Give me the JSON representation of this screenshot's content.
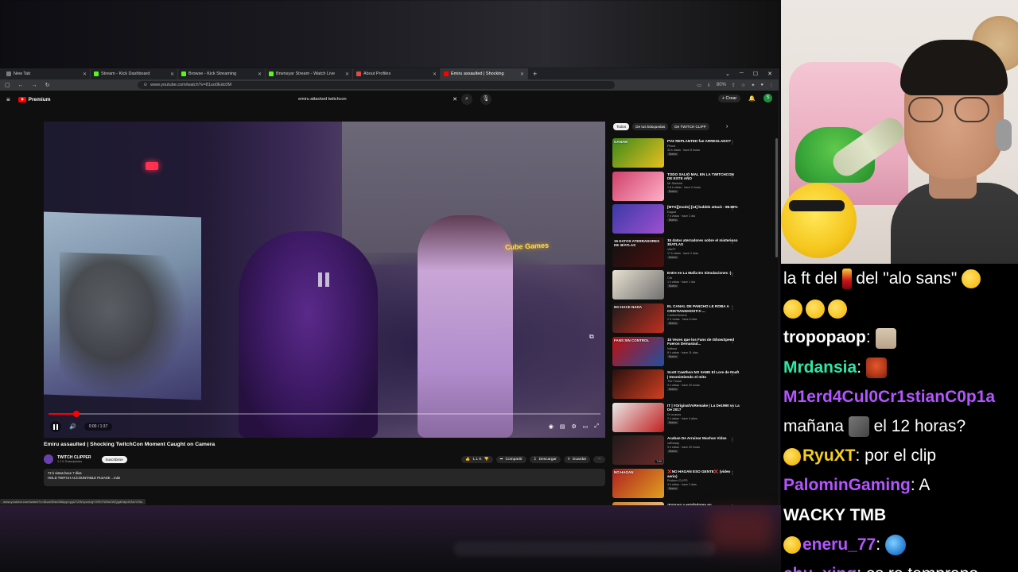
{
  "browser": {
    "tabs": [
      {
        "label": "New Tab",
        "favicon_color": "#7a7a7a",
        "active": false
      },
      {
        "label": "Stream - Kick Dashboard",
        "favicon_color": "#53fc18",
        "active": false
      },
      {
        "label": "Browse - Kick Streaming",
        "favicon_color": "#53fc18",
        "active": false
      },
      {
        "label": "Brwnsyar Stream - Watch Live",
        "favicon_color": "#53fc18",
        "active": false
      },
      {
        "label": "About Profiles",
        "favicon_color": "#e04a4a",
        "active": false
      },
      {
        "label": "Emiru assaulted | Shocking",
        "favicon_color": "#ff0000",
        "active": true
      }
    ],
    "url": "www.youtube.com/watch?v=81uo0Edc0M",
    "zoom": "80%"
  },
  "youtube": {
    "logo_label": "Premium",
    "search_query": "emiru attacked twitchcon",
    "create_label": "Crear",
    "avatar_letter": "S"
  },
  "video": {
    "neon_sign": "Cube Games",
    "time": "0:00 / 1:37",
    "progress_fraction": 0.05,
    "title": "Emiru assaulted | Shocking TwitchCon Moment Caught on Camera",
    "channel": "TWITCH CLIPPER",
    "subscribers": "1.1 K Suscriptores",
    "subscribe_label": "Suscribirse",
    "likes": "1.1 K",
    "share_label": "Compartir",
    "download_label": "Descargar",
    "save_label": "Guardar",
    "desc_line1": "72 k vistas  hace 7 días",
    "desc_line2": "HOLD TWITCH ACCOUNTABLE PLEASE ...más",
    "status_url": "www.youtube.com/watch?v=81zo0Edc0M&pp=ygUYZW1pcnUgYXR0YWNrZWQgdHdpdGNoY29u"
  },
  "chips": [
    "Todos",
    "De tus búsquedas",
    "De TWITCH CLIPP"
  ],
  "related": [
    {
      "title": "PVZ REPLANTED fue ARREGLADO?",
      "channel": "Pfrost",
      "views": "33 k vistas · hace 8 horas",
      "badge": "Nuevo",
      "thumb_text": "GANAM",
      "colors": [
        "#3a8a1a",
        "#e8c020"
      ],
      "duration": ""
    },
    {
      "title": "TODO SALIÓ MAL EN LA TWITCHCON DE ESTE AÑO",
      "channel": "Mr Sketchit",
      "views": "1.8 k vistas · hace 2 horas",
      "badge": "Nuevo",
      "thumb_text": "",
      "colors": [
        "#d0406a",
        "#ffb0c8"
      ],
      "duration": ""
    },
    {
      "title": "[MTG][mods] [14] bubble attack - 88.69%",
      "channel": "Eagod",
      "views": "7 k vistas · hace 1 día",
      "badge": "Nuevo",
      "thumb_text": "",
      "colors": [
        "#3a3aa8",
        "#a050d0"
      ],
      "duration": ""
    },
    {
      "title": "15 datos aterradores sobre el misterioso 3I/ATLAS",
      "channel": "VidOT",
      "views": "17 k vistas · hace 2 días",
      "badge": "Nuevo",
      "thumb_text": "15 DATOS ATERRADORES DE 3I/ATLAS",
      "colors": [
        "#111111",
        "#4a1010"
      ],
      "duration": ""
    },
    {
      "title": "Entre en La Mafia En Simulaciones :)",
      "channel": "Clix",
      "views": "1 k vistas · hace 1 día",
      "badge": "Nuevo",
      "thumb_text": "",
      "colors": [
        "#e8e0d0",
        "#707070"
      ],
      "duration": ""
    },
    {
      "title": "EL CANAL DE PANCHO LE ROBA A CRISTIANGHOST!!! ...",
      "channel": "CaritenNeutral",
      "views": "2 K vistas · hace 6 días",
      "badge": "Nuevo",
      "thumb_text": "NO HACE NADA",
      "colors": [
        "#1a1a1a",
        "#c03020"
      ],
      "duration": ""
    },
    {
      "title": "15 Veces que los Fans de IShowSpeed Fueron Demasiad...",
      "channel": "Nafusa",
      "views": "8 k vistas · hace 11 días",
      "badge": "Nuevo",
      "thumb_text": "FANS SIN CONTROL",
      "colors": [
        "#c01010",
        "#2050a0"
      ],
      "duration": ""
    },
    {
      "title": "Scott Cawthon NO SABE El Lore de Fnaf! | Desmintiendo el mito",
      "channel": "The Fnash",
      "views": "9 k vistas · hace 20 horas",
      "badge": "Nuevo",
      "thumb_text": "",
      "colors": [
        "#2a1010",
        "#d04020"
      ],
      "duration": ""
    },
    {
      "title": "IT | #OriginalVsRemake | La De1990 vs La De 2017",
      "channel": "Dr ocasos",
      "views": "2 k vistas · hace 4 años",
      "badge": "Nuevo",
      "thumb_text": "",
      "colors": [
        "#e8e8e8",
        "#c02020"
      ],
      "duration": ""
    },
    {
      "title": "Acaban De Arrainar Muchas Vidas",
      "channel": "xdReady",
      "views": "9 k vistas · hace 20 horas",
      "badge": "Nuevo",
      "thumb_text": "",
      "colors": [
        "#201a1a",
        "#6a2a2a"
      ],
      "duration": "7:00"
    },
    {
      "title": "❌NO HAGAN ESO GENTE❌ (video serio)",
      "channel": "Rodorm CLIPS",
      "views": "4 k vistas · hace 2 días",
      "badge": "Nuevo",
      "thumb_text": "NO HAGAN",
      "colors": [
        "#b02020",
        "#e0a020"
      ],
      "duration": ""
    },
    {
      "title": "¡Expuso a estafadores en",
      "channel": "",
      "views": "",
      "badge": "",
      "thumb_text": "",
      "colors": [
        "#d08030",
        "#f0d0a0"
      ],
      "duration": ""
    }
  ],
  "chat": [
    {
      "user": "",
      "text": "la ft del",
      "after": "del \"alo sans\"",
      "user_color": "#ffffff"
    },
    {
      "user": "",
      "text": "",
      "after": "",
      "user_color": "#ffffff"
    },
    {
      "user": "tropopaop",
      "text": ":",
      "after": "",
      "user_color": "#ffffff"
    },
    {
      "user": "Mrdansia",
      "text": ":",
      "after": "",
      "user_color": "#2ee8a8"
    },
    {
      "user": "M1erd4Cul0Cr1stianC0p1a",
      "text": "",
      "after": "",
      "user_color": "#b455ff"
    },
    {
      "user": "",
      "text": "mañana",
      "after": "el 12 horas?",
      "user_color": "#ffffff"
    },
    {
      "user": "RyuXT",
      "text": ": por el clip",
      "after": "",
      "user_color": "#f5d020"
    },
    {
      "user": "PalominGaming",
      "text": ": A",
      "after": "",
      "user_color": "#b455ff"
    },
    {
      "user": "",
      "text": "WACKY TMB",
      "after": "",
      "user_color": "#ffffff"
    },
    {
      "user": "eneru_77",
      "text": ":",
      "after": "",
      "user_color": "#b455ff"
    },
    {
      "user": "chu_xing",
      "text": ": es re temprano",
      "after": "",
      "user_color": "#b455ff"
    }
  ]
}
